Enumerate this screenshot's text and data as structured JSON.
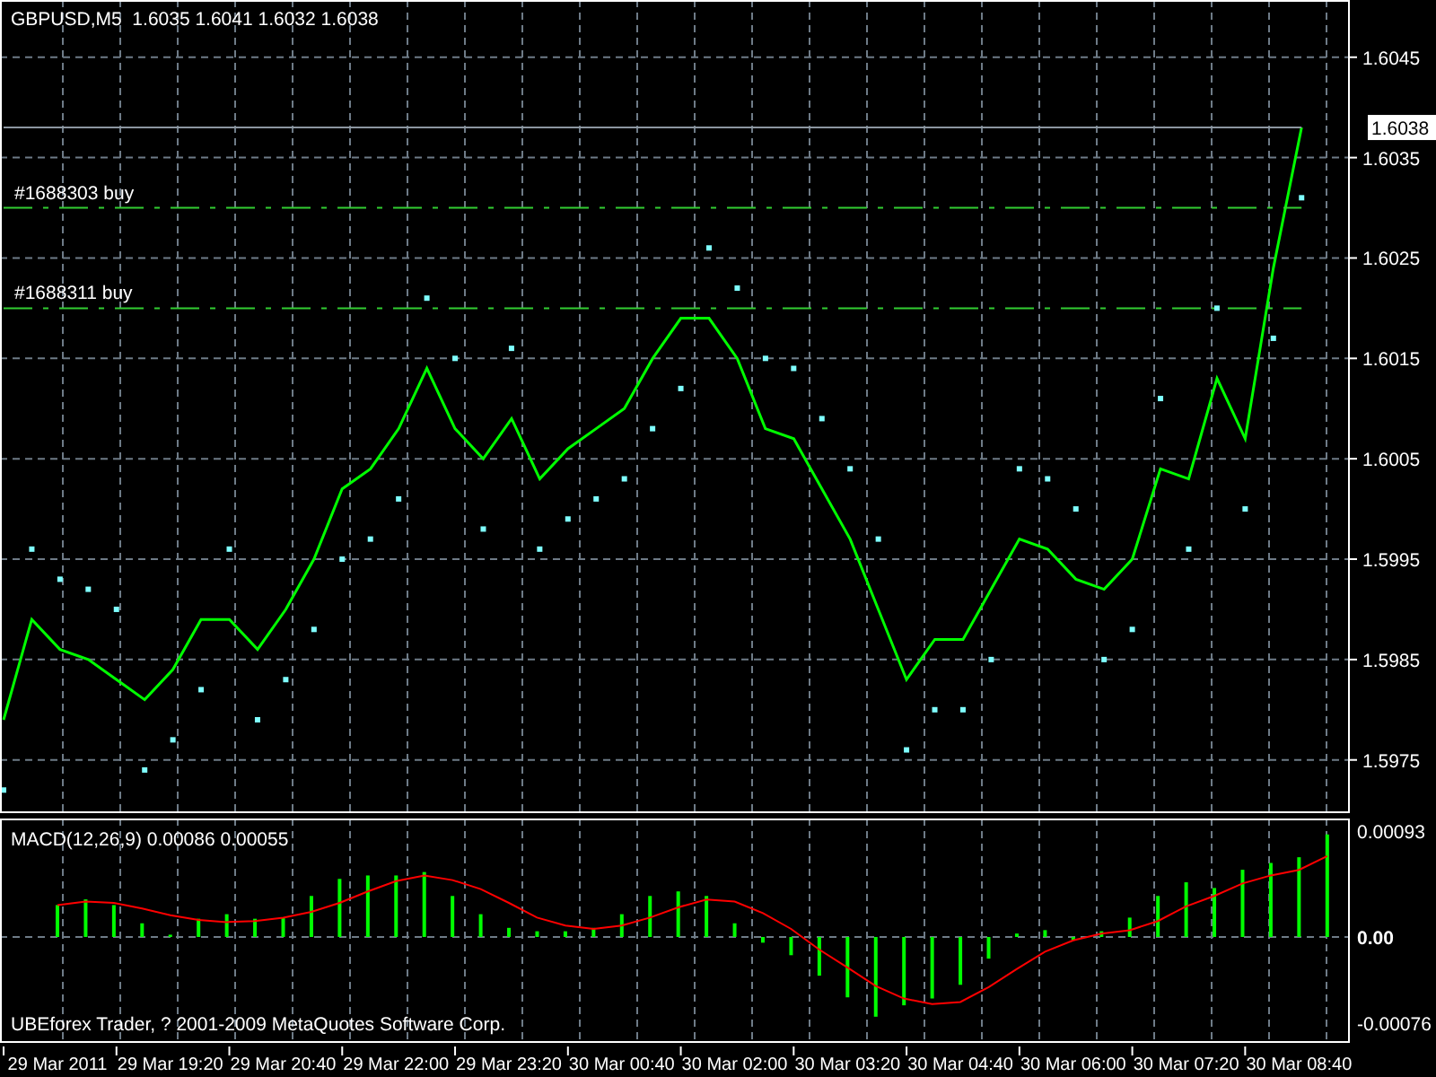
{
  "chart": {
    "header": "GBPUSD,M5  1.6035 1.6041 1.6032 1.6038",
    "bid_tag": "1.6038",
    "chart_data": {
      "type": "line",
      "grid": true,
      "categories": [
        null,
        null,
        null,
        null,
        null,
        null,
        null,
        null,
        null,
        null,
        null,
        null,
        null,
        null,
        null,
        null,
        null,
        null,
        null,
        null,
        null,
        null,
        null,
        null,
        null,
        null,
        null,
        null,
        null,
        null,
        null,
        null,
        null,
        null,
        null,
        null,
        null,
        null,
        null,
        null,
        null,
        null,
        null,
        null,
        null,
        null,
        null
      ],
      "series": [
        {
          "color": "#00ff00",
          "values": [
            1.5979,
            1.5989,
            1.5986,
            1.5985,
            1.5983,
            1.5981,
            1.5984,
            1.5989,
            1.5989,
            1.5986,
            1.599,
            1.5995,
            1.6002,
            1.6004,
            1.6008,
            1.6014,
            1.6008,
            1.6005,
            1.6009,
            1.6003,
            1.6006,
            1.6008,
            1.601,
            1.6015,
            1.6019,
            1.6019,
            1.6015,
            1.6008,
            1.6007,
            1.6002,
            1.5997,
            1.599,
            1.5983,
            1.5987,
            1.5987,
            1.5992,
            1.5997,
            1.5996,
            1.5993,
            1.5992,
            1.5995,
            1.6004,
            1.6003,
            1.6013,
            1.6007,
            1.6024,
            1.6038
          ]
        },
        {
          "type": "line",
          "color": "#8c96a0",
          "values": [
            1.6038,
            1.6038,
            1.6038,
            1.6038,
            1.6038,
            1.6038,
            1.6038,
            1.6038,
            1.6038,
            1.6038,
            1.6038,
            1.6038,
            1.6038,
            1.6038,
            1.6038,
            1.6038,
            1.6038,
            1.6038,
            1.6038,
            1.6038,
            1.6038,
            1.6038,
            1.6038,
            1.6038,
            1.6038,
            1.6038,
            1.6038,
            1.6038,
            1.6038,
            1.6038,
            1.6038,
            1.6038,
            1.6038,
            1.6038,
            1.6038,
            1.6038,
            1.6038,
            1.6038,
            1.6038,
            1.6038,
            1.6038,
            1.6038,
            1.6038,
            1.6038,
            1.6038,
            1.6038,
            1.6038
          ]
        },
        {
          "type": "line",
          "name": "#1688303 buy",
          "color": "#32cd32",
          "line_style": "dashdot",
          "values": [
            1.603,
            1.603,
            1.603,
            1.603,
            1.603,
            1.603,
            1.603,
            1.603,
            1.603,
            1.603,
            1.603,
            1.603,
            1.603,
            1.603,
            1.603,
            1.603,
            1.603,
            1.603,
            1.603,
            1.603,
            1.603,
            1.603,
            1.603,
            1.603,
            1.603,
            1.603,
            1.603,
            1.603,
            1.603,
            1.603,
            1.603,
            1.603,
            1.603,
            1.603,
            1.603,
            1.603,
            1.603,
            1.603,
            1.603,
            1.603,
            1.603,
            1.603,
            1.603,
            1.603,
            1.603,
            1.603,
            1.603
          ]
        },
        {
          "type": "line",
          "name": "#1688311 buy",
          "color": "#32cd32",
          "line_style": "dashdot",
          "values": [
            1.602,
            1.602,
            1.602,
            1.602,
            1.602,
            1.602,
            1.602,
            1.602,
            1.602,
            1.602,
            1.602,
            1.602,
            1.602,
            1.602,
            1.602,
            1.602,
            1.602,
            1.602,
            1.602,
            1.602,
            1.602,
            1.602,
            1.602,
            1.602,
            1.602,
            1.602,
            1.602,
            1.602,
            1.602,
            1.602,
            1.602,
            1.602,
            1.602,
            1.602,
            1.602,
            1.602,
            1.602,
            1.602,
            1.602,
            1.602,
            1.602,
            1.602,
            1.602,
            1.602,
            1.602,
            1.602,
            1.602
          ]
        },
        {
          "type": "scatter",
          "color": "#7fffff",
          "values": [
            1.5972,
            1.5996,
            1.5993,
            1.5992,
            1.599,
            1.5974,
            1.5977,
            1.5982,
            1.5996,
            1.5979,
            1.5983,
            1.5988,
            1.5995,
            1.5997,
            1.6001,
            1.6021,
            1.6015,
            1.5998,
            1.6016,
            1.5996,
            1.5999,
            1.6001,
            1.6003,
            1.6008,
            1.6012,
            1.6026,
            1.6022,
            1.6015,
            1.6014,
            1.6009,
            1.6004,
            1.5997,
            1.5976,
            1.598,
            1.598,
            1.5985,
            1.6004,
            1.6003,
            1.6,
            1.5985,
            1.5988,
            1.6011,
            1.5996,
            1.602,
            1.6,
            1.6017,
            1.6031
          ]
        }
      ],
      "ylim": [
        1.59697,
        1.60507
      ],
      "yticks": [
        {
          "value": 1.6045,
          "label": "1.6045"
        },
        {
          "value": 1.6035,
          "label": "1.6035"
        },
        {
          "value": 1.6025,
          "label": "1.6025"
        },
        {
          "value": 1.6015,
          "label": "1.6015"
        },
        {
          "value": 1.6005,
          "label": "1.6005"
        },
        {
          "value": 1.5995,
          "label": "1.5995"
        },
        {
          "value": 1.5985,
          "label": "1.5985"
        },
        {
          "value": 1.5975,
          "label": "1.5975"
        }
      ]
    }
  },
  "indicator": {
    "header": "MACD(12,26,9) 0.00086 0.00055",
    "chart_data": {
      "type": "bar",
      "grid": true,
      "categories": [
        "29 Mar 2011",
        null,
        null,
        null,
        "29 Mar 19:20",
        null,
        null,
        null,
        "29 Mar 20:40",
        null,
        null,
        null,
        "29 Mar 22:00",
        null,
        null,
        null,
        "29 Mar 23:20",
        null,
        null,
        null,
        "30 Mar 00:40",
        null,
        null,
        null,
        "30 Mar 02:00",
        null,
        null,
        null,
        "30 Mar 03:20",
        null,
        null,
        null,
        "30 Mar 04:40",
        null,
        null,
        null,
        "30 Mar 06:00",
        null,
        null,
        null,
        "30 Mar 07:20",
        null,
        null,
        null,
        "30 Mar 08:40",
        null
      ],
      "series": [
        {
          "color": "#00ff00",
          "values": [
            0.00028,
            0.00033,
            0.00028,
            0.00012,
            2e-05,
            0.00016,
            0.0002,
            0.00016,
            0.00017,
            0.00036,
            0.00051,
            0.00054,
            0.00054,
            0.00057,
            0.00036,
            0.0002,
            8e-05,
            5e-05,
            5e-05,
            8e-05,
            0.0002,
            0.00036,
            0.0004,
            0.00036,
            0.00012,
            -5e-05,
            -0.00016,
            -0.00034,
            -0.00053,
            -0.0007,
            -0.0006,
            -0.00054,
            -0.00042,
            -0.00019,
            3e-05,
            6e-05,
            -3e-05,
            5e-05,
            0.00017,
            0.00036,
            0.00048,
            0.00043,
            0.00059,
            0.00065,
            0.0007,
            0.0009
          ]
        },
        {
          "type": "line",
          "color": "#ff0000",
          "values": [
            0.00028,
            0.00031,
            0.0003,
            0.00025,
            0.00019,
            0.00015,
            0.00013,
            0.00014,
            0.00017,
            0.00022,
            0.0003,
            0.0004,
            0.00049,
            0.00054,
            0.0005,
            0.00042,
            0.0003,
            0.00017,
            0.0001,
            7e-05,
            0.0001,
            0.00017,
            0.00026,
            0.00033,
            0.00031,
            0.00021,
            7e-05,
            -0.00011,
            -0.00027,
            -0.00043,
            -0.00054,
            -0.00059,
            -0.00057,
            -0.00044,
            -0.00028,
            -0.00013,
            -3e-05,
            3e-05,
            6e-05,
            0.00014,
            0.00027,
            0.00036,
            0.00047,
            0.00054,
            0.00059,
            0.00071
          ]
        }
      ],
      "ylim": [
        -0.00093,
        0.00104
      ],
      "yticks": [
        {
          "value": 0.00093,
          "label": "0.00093"
        },
        {
          "value": 0,
          "label": "0.00"
        },
        {
          "value": -0.00076,
          "label": "-0.00076"
        }
      ]
    }
  },
  "footer": "UBEforex Trader, ? 2001-2009 MetaQuotes Software Corp."
}
